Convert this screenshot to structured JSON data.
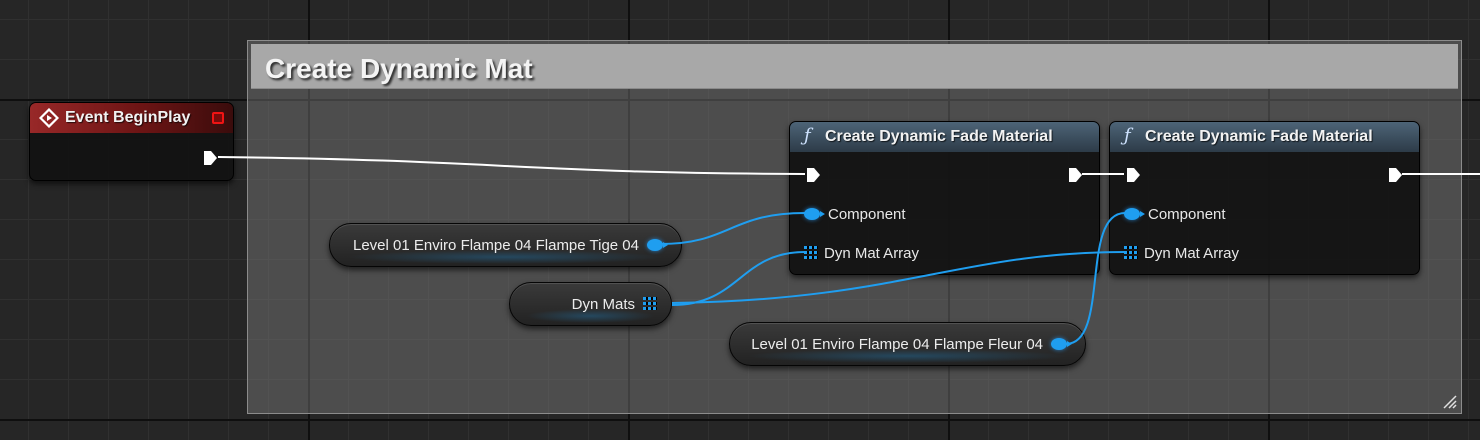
{
  "comment": {
    "title": "Create Dynamic Mat"
  },
  "event_node": {
    "title": "Event BeginPlay"
  },
  "function_nodes": [
    {
      "title": "Create Dynamic Fade Material",
      "pins": [
        "Component",
        "Dyn Mat Array"
      ]
    },
    {
      "title": "Create Dynamic Fade Material",
      "pins": [
        "Component",
        "Dyn Mat Array"
      ]
    }
  ],
  "variables": [
    {
      "label": "Level 01 Enviro Flampe 04 Flampe Tige 04",
      "type": "object"
    },
    {
      "label": "Dyn Mats",
      "type": "array"
    },
    {
      "label": "Level 01 Enviro Flampe 04 Flampe Fleur 04",
      "type": "object"
    }
  ],
  "colors": {
    "exec_wire": "#ffffff",
    "object_pin": "#1f9ef0",
    "event_header": "#982828",
    "function_header": "#4d6477",
    "delegate_pin": "#f01414"
  }
}
